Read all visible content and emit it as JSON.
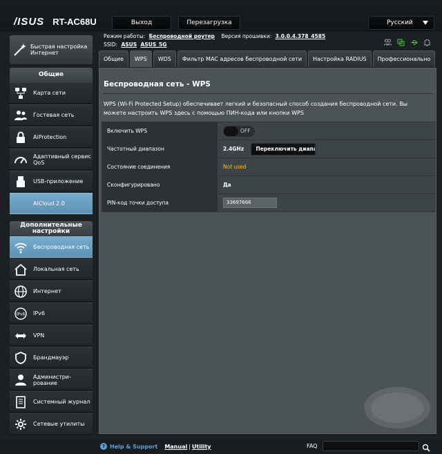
{
  "header": {
    "brand": "/ISUS",
    "model": "RT-AC68U",
    "logout": "Выход",
    "reboot": "Перезагрузка",
    "language": "Русский"
  },
  "status": {
    "mode_label": "Режим работы:",
    "mode_value": "Беспроводной роутер",
    "firmware_label": "Версия прошивки:",
    "firmware_value": "3.0.0.4.378_4585",
    "ssid_label": "SSID:",
    "ssid_1": "ASUS",
    "ssid_2": "ASUS_5G"
  },
  "sidebar": {
    "quick_setup": "Быстрая настройка Интернет",
    "general_header": "Общие",
    "general_items": [
      {
        "label": "Карта сети",
        "icon": "network-map-icon"
      },
      {
        "label": "Гостевая сеть",
        "icon": "guest-network-icon"
      },
      {
        "label": "AiProtection",
        "icon": "aiprotection-icon"
      },
      {
        "label": "Адаптивный сервис QoS",
        "icon": "qos-gauge-icon"
      },
      {
        "label": "USB-приложение",
        "icon": "usb-icon"
      },
      {
        "label": "AiCloud 2.0",
        "icon": "aicloud-icon"
      }
    ],
    "advanced_header": "Дополнительные настройки",
    "advanced_items": [
      {
        "label": "Беспроводная сеть",
        "icon": "wireless-icon"
      },
      {
        "label": "Локальная сеть",
        "icon": "home-lan-icon"
      },
      {
        "label": "Интернет",
        "icon": "globe-icon"
      },
      {
        "label": "IPv6",
        "icon": "ipv6-icon"
      },
      {
        "label": "VPN",
        "icon": "vpn-icon"
      },
      {
        "label": "Брандмауэр",
        "icon": "firewall-icon"
      },
      {
        "label": "Администри-рование",
        "icon": "admin-icon"
      },
      {
        "label": "Системный журнал",
        "icon": "system-log-icon"
      },
      {
        "label": "Сетевые утилиты",
        "icon": "network-tools-icon"
      }
    ]
  },
  "tabs": [
    {
      "label": "Общие",
      "active": false
    },
    {
      "label": "WPS",
      "active": true
    },
    {
      "label": "WDS",
      "active": false
    },
    {
      "label": "Фильтр MAC адресов беспроводной сети",
      "active": false
    },
    {
      "label": "Настройка RADIUS",
      "active": false
    },
    {
      "label": "Профессионально",
      "active": false
    }
  ],
  "main": {
    "title": "Беспроводная сеть - WPS",
    "description": "WPS (Wi-Fi Protected Setup) обеспечивает легкий и безопасный способ создания беспроводной сети. Вы можете настроить WPS здесь с помощью ПИН-кода или кнопки WPS",
    "rows": {
      "enable_label": "Включить WPS",
      "enable_state": "OFF",
      "band_label": "Частотный диапазон",
      "band_value": "2.4GHz",
      "band_button": "Переключить диапазон",
      "conn_label": "Состояние соединения",
      "conn_value": "Not used",
      "configured_label": "Сконфигурировано",
      "configured_value": "Да",
      "pin_label": "PIN-код точки доступа",
      "pin_value": "33697666"
    }
  },
  "footer": {
    "help": "Help & Support",
    "manual": "Manual",
    "sep": "|",
    "utility": "Utility",
    "faq": "FAQ"
  },
  "colors": {
    "accent_blue": "#5a9fd4",
    "active_sidebar": "#6b9fc2",
    "not_used_yellow": "#ffc107",
    "status_green": "#3fcf3f"
  }
}
